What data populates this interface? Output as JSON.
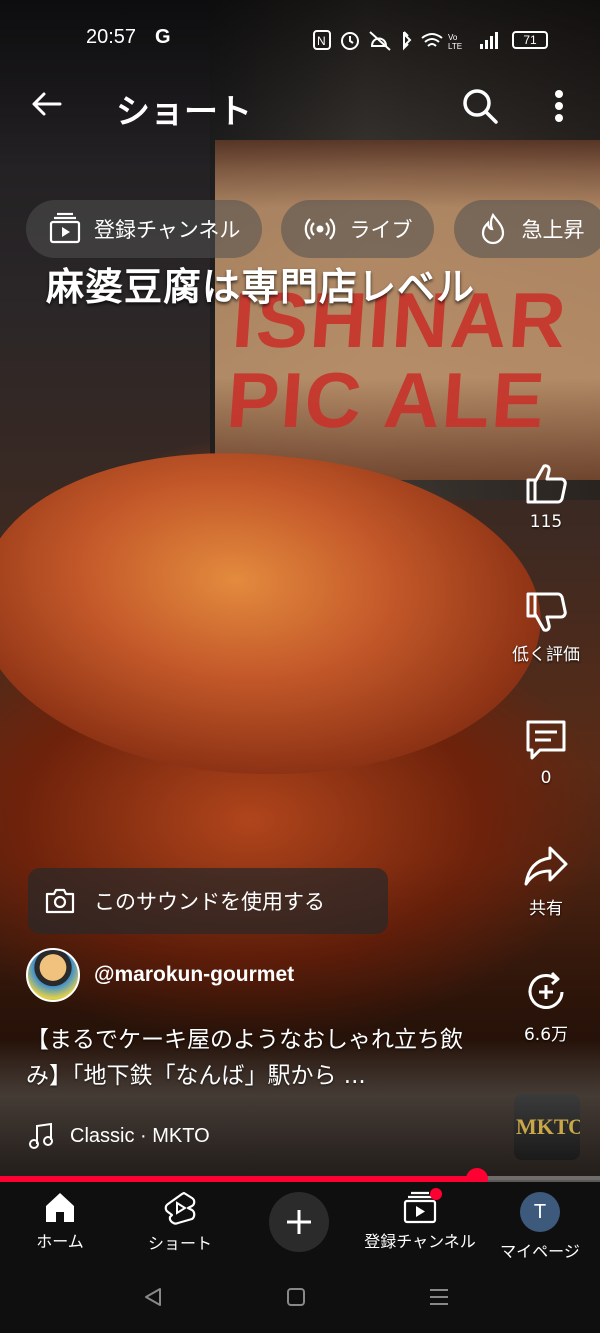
{
  "status_bar": {
    "time": "20:57",
    "g_badge": "G",
    "sys_icons": "N ⏰ 🔕 ✱ ≋ VoLTE ▮",
    "battery": "71"
  },
  "header": {
    "title": "ショート",
    "back_icon": "arrow-left-icon",
    "search_icon": "search-icon",
    "more_icon": "more-vert-icon"
  },
  "chips": [
    {
      "label": "登録チャンネル",
      "icon": "subscriptions-icon"
    },
    {
      "label": "ライブ",
      "icon": "live-icon"
    },
    {
      "label": "急上昇",
      "icon": "trending-icon"
    }
  ],
  "video": {
    "caption_overlay": "麻婆豆腐は専門店レベル",
    "jar_text": "ISHINAR\nPIC ALE"
  },
  "actions": {
    "like_count": "115",
    "dislike_label": "低く評価",
    "comment_count": "0",
    "share_label": "共有",
    "remix_count": "6.6万"
  },
  "sound_button": {
    "label": "このサウンドを使用する",
    "icon": "camera-icon"
  },
  "channel": {
    "handle": "@marokun-gourmet"
  },
  "description": "【まるでケーキ屋のようなおしゃれ立ち飲み】「地下鉄「なんば」駅から ...",
  "music": {
    "label": "Classic · MKTO",
    "thumb_text": "MKTO"
  },
  "progress": {
    "percent": 79.5
  },
  "bottom_nav": {
    "home": "ホーム",
    "shorts": "ショート",
    "subscriptions": "登録チャンネル",
    "mypage": "マイページ",
    "avatar_letter": "T"
  },
  "colors": {
    "accent": "#ff0033",
    "nav_bg": "#0f0f0f",
    "chip_bg": "#505050"
  }
}
